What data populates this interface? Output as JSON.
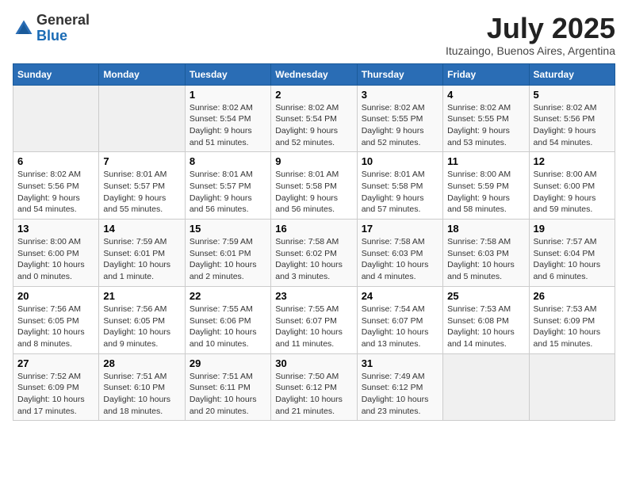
{
  "logo": {
    "general": "General",
    "blue": "Blue"
  },
  "title": {
    "month_year": "July 2025",
    "location": "Ituzaingo, Buenos Aires, Argentina"
  },
  "days_of_week": [
    "Sunday",
    "Monday",
    "Tuesday",
    "Wednesday",
    "Thursday",
    "Friday",
    "Saturday"
  ],
  "weeks": [
    [
      {
        "day": "",
        "sunrise": "",
        "sunset": "",
        "daylight": ""
      },
      {
        "day": "",
        "sunrise": "",
        "sunset": "",
        "daylight": ""
      },
      {
        "day": "1",
        "sunrise": "Sunrise: 8:02 AM",
        "sunset": "Sunset: 5:54 PM",
        "daylight": "Daylight: 9 hours and 51 minutes."
      },
      {
        "day": "2",
        "sunrise": "Sunrise: 8:02 AM",
        "sunset": "Sunset: 5:54 PM",
        "daylight": "Daylight: 9 hours and 52 minutes."
      },
      {
        "day": "3",
        "sunrise": "Sunrise: 8:02 AM",
        "sunset": "Sunset: 5:55 PM",
        "daylight": "Daylight: 9 hours and 52 minutes."
      },
      {
        "day": "4",
        "sunrise": "Sunrise: 8:02 AM",
        "sunset": "Sunset: 5:55 PM",
        "daylight": "Daylight: 9 hours and 53 minutes."
      },
      {
        "day": "5",
        "sunrise": "Sunrise: 8:02 AM",
        "sunset": "Sunset: 5:56 PM",
        "daylight": "Daylight: 9 hours and 54 minutes."
      }
    ],
    [
      {
        "day": "6",
        "sunrise": "Sunrise: 8:02 AM",
        "sunset": "Sunset: 5:56 PM",
        "daylight": "Daylight: 9 hours and 54 minutes."
      },
      {
        "day": "7",
        "sunrise": "Sunrise: 8:01 AM",
        "sunset": "Sunset: 5:57 PM",
        "daylight": "Daylight: 9 hours and 55 minutes."
      },
      {
        "day": "8",
        "sunrise": "Sunrise: 8:01 AM",
        "sunset": "Sunset: 5:57 PM",
        "daylight": "Daylight: 9 hours and 56 minutes."
      },
      {
        "day": "9",
        "sunrise": "Sunrise: 8:01 AM",
        "sunset": "Sunset: 5:58 PM",
        "daylight": "Daylight: 9 hours and 56 minutes."
      },
      {
        "day": "10",
        "sunrise": "Sunrise: 8:01 AM",
        "sunset": "Sunset: 5:58 PM",
        "daylight": "Daylight: 9 hours and 57 minutes."
      },
      {
        "day": "11",
        "sunrise": "Sunrise: 8:00 AM",
        "sunset": "Sunset: 5:59 PM",
        "daylight": "Daylight: 9 hours and 58 minutes."
      },
      {
        "day": "12",
        "sunrise": "Sunrise: 8:00 AM",
        "sunset": "Sunset: 6:00 PM",
        "daylight": "Daylight: 9 hours and 59 minutes."
      }
    ],
    [
      {
        "day": "13",
        "sunrise": "Sunrise: 8:00 AM",
        "sunset": "Sunset: 6:00 PM",
        "daylight": "Daylight: 10 hours and 0 minutes."
      },
      {
        "day": "14",
        "sunrise": "Sunrise: 7:59 AM",
        "sunset": "Sunset: 6:01 PM",
        "daylight": "Daylight: 10 hours and 1 minute."
      },
      {
        "day": "15",
        "sunrise": "Sunrise: 7:59 AM",
        "sunset": "Sunset: 6:01 PM",
        "daylight": "Daylight: 10 hours and 2 minutes."
      },
      {
        "day": "16",
        "sunrise": "Sunrise: 7:58 AM",
        "sunset": "Sunset: 6:02 PM",
        "daylight": "Daylight: 10 hours and 3 minutes."
      },
      {
        "day": "17",
        "sunrise": "Sunrise: 7:58 AM",
        "sunset": "Sunset: 6:03 PM",
        "daylight": "Daylight: 10 hours and 4 minutes."
      },
      {
        "day": "18",
        "sunrise": "Sunrise: 7:58 AM",
        "sunset": "Sunset: 6:03 PM",
        "daylight": "Daylight: 10 hours and 5 minutes."
      },
      {
        "day": "19",
        "sunrise": "Sunrise: 7:57 AM",
        "sunset": "Sunset: 6:04 PM",
        "daylight": "Daylight: 10 hours and 6 minutes."
      }
    ],
    [
      {
        "day": "20",
        "sunrise": "Sunrise: 7:56 AM",
        "sunset": "Sunset: 6:05 PM",
        "daylight": "Daylight: 10 hours and 8 minutes."
      },
      {
        "day": "21",
        "sunrise": "Sunrise: 7:56 AM",
        "sunset": "Sunset: 6:05 PM",
        "daylight": "Daylight: 10 hours and 9 minutes."
      },
      {
        "day": "22",
        "sunrise": "Sunrise: 7:55 AM",
        "sunset": "Sunset: 6:06 PM",
        "daylight": "Daylight: 10 hours and 10 minutes."
      },
      {
        "day": "23",
        "sunrise": "Sunrise: 7:55 AM",
        "sunset": "Sunset: 6:07 PM",
        "daylight": "Daylight: 10 hours and 11 minutes."
      },
      {
        "day": "24",
        "sunrise": "Sunrise: 7:54 AM",
        "sunset": "Sunset: 6:07 PM",
        "daylight": "Daylight: 10 hours and 13 minutes."
      },
      {
        "day": "25",
        "sunrise": "Sunrise: 7:53 AM",
        "sunset": "Sunset: 6:08 PM",
        "daylight": "Daylight: 10 hours and 14 minutes."
      },
      {
        "day": "26",
        "sunrise": "Sunrise: 7:53 AM",
        "sunset": "Sunset: 6:09 PM",
        "daylight": "Daylight: 10 hours and 15 minutes."
      }
    ],
    [
      {
        "day": "27",
        "sunrise": "Sunrise: 7:52 AM",
        "sunset": "Sunset: 6:09 PM",
        "daylight": "Daylight: 10 hours and 17 minutes."
      },
      {
        "day": "28",
        "sunrise": "Sunrise: 7:51 AM",
        "sunset": "Sunset: 6:10 PM",
        "daylight": "Daylight: 10 hours and 18 minutes."
      },
      {
        "day": "29",
        "sunrise": "Sunrise: 7:51 AM",
        "sunset": "Sunset: 6:11 PM",
        "daylight": "Daylight: 10 hours and 20 minutes."
      },
      {
        "day": "30",
        "sunrise": "Sunrise: 7:50 AM",
        "sunset": "Sunset: 6:12 PM",
        "daylight": "Daylight: 10 hours and 21 minutes."
      },
      {
        "day": "31",
        "sunrise": "Sunrise: 7:49 AM",
        "sunset": "Sunset: 6:12 PM",
        "daylight": "Daylight: 10 hours and 23 minutes."
      },
      {
        "day": "",
        "sunrise": "",
        "sunset": "",
        "daylight": ""
      },
      {
        "day": "",
        "sunrise": "",
        "sunset": "",
        "daylight": ""
      }
    ]
  ]
}
